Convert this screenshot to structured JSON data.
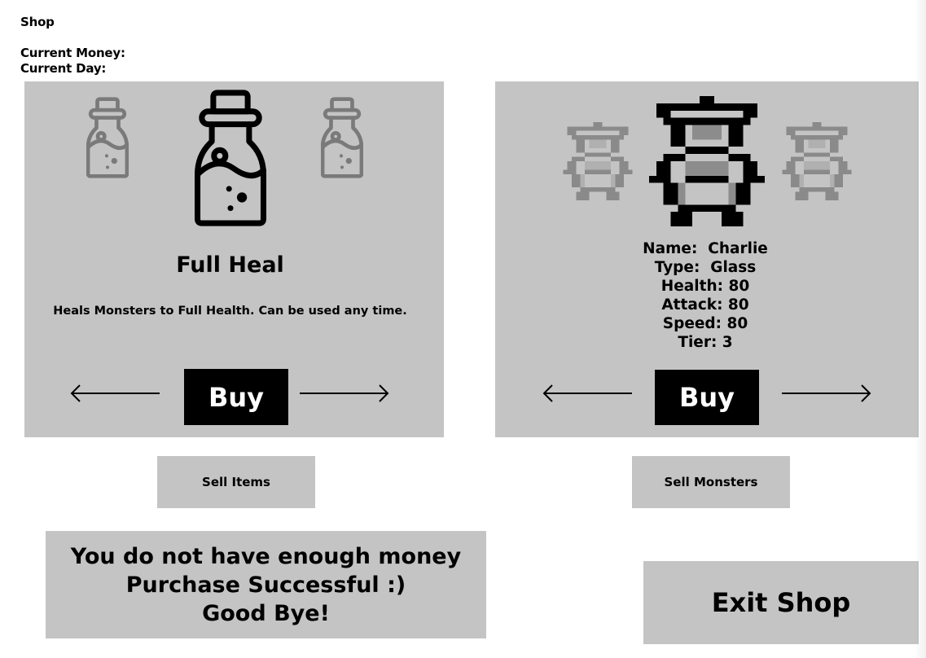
{
  "header": {
    "title": "Shop",
    "money_label": "Current Money:",
    "day_label": "Current Day:"
  },
  "items_panel": {
    "item_name": "Full Heal",
    "item_description": "Heals Monsters to Full Health. Can be used any time.",
    "buy_label": "Buy",
    "prev_icon": "left-arrow-icon",
    "next_icon": "right-arrow-icon",
    "item_icon": "potion-bottle-icon"
  },
  "monsters_panel": {
    "stats": [
      "Name:  Charlie",
      "Type:  Glass",
      "Health: 80",
      "Attack: 80",
      "Speed: 80",
      "Tier: 3"
    ],
    "buy_label": "Buy",
    "prev_icon": "left-arrow-icon",
    "next_icon": "right-arrow-icon",
    "monster_icon": "pixel-monster-sprite"
  },
  "sell_items_label": "Sell Items",
  "sell_monsters_label": "Sell Monsters",
  "messages": [
    "You do not have enough money",
    "Purchase Successful :)",
    "Good Bye!"
  ],
  "exit_label": "Exit Shop",
  "colors": {
    "panel": "#c4c4c4",
    "background": "#ffffff",
    "button": "#000000",
    "faded_icon": "#7a7a7a"
  }
}
